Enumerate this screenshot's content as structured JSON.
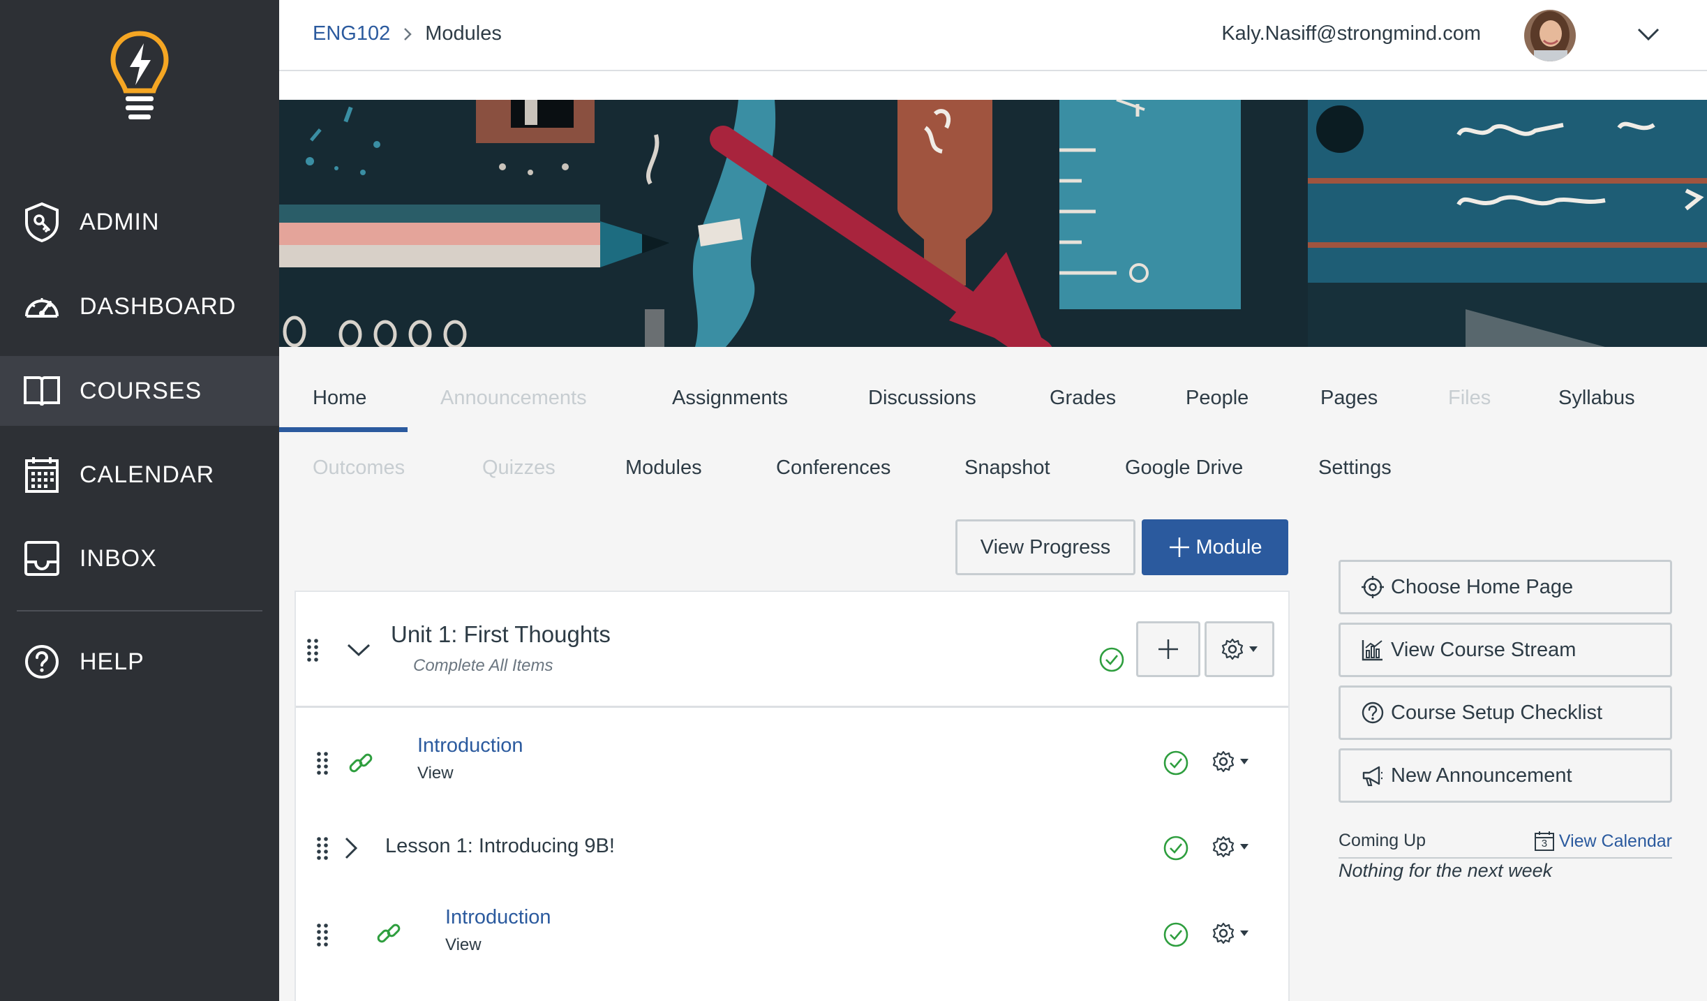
{
  "sidebar": {
    "items": [
      {
        "label": "ADMIN",
        "icon": "shield-icon"
      },
      {
        "label": "DASHBOARD",
        "icon": "speedometer-icon"
      },
      {
        "label": "COURSES",
        "icon": "book-icon"
      },
      {
        "label": "CALENDAR",
        "icon": "calendar-icon"
      },
      {
        "label": "INBOX",
        "icon": "inbox-icon"
      },
      {
        "label": "HELP",
        "icon": "help-circle-icon"
      }
    ],
    "active": "COURSES"
  },
  "header": {
    "breadcrumb_course": "ENG102",
    "breadcrumb_current": "Modules",
    "user_email": "Kaly.Nasiff@strongmind.com"
  },
  "course_nav": {
    "row1": [
      {
        "label": "Home",
        "disabled": false
      },
      {
        "label": "Announcements",
        "disabled": true
      },
      {
        "label": "Assignments",
        "disabled": false
      },
      {
        "label": "Discussions",
        "disabled": false
      },
      {
        "label": "Grades",
        "disabled": false
      },
      {
        "label": "People",
        "disabled": false
      },
      {
        "label": "Pages",
        "disabled": false
      },
      {
        "label": "Files",
        "disabled": true
      },
      {
        "label": "Syllabus",
        "disabled": false
      }
    ],
    "row2": [
      {
        "label": "Outcomes",
        "disabled": true
      },
      {
        "label": "Quizzes",
        "disabled": true
      },
      {
        "label": "Modules",
        "disabled": false
      },
      {
        "label": "Conferences",
        "disabled": false
      },
      {
        "label": "Snapshot",
        "disabled": false
      },
      {
        "label": "Google Drive",
        "disabled": false
      },
      {
        "label": "Settings",
        "disabled": false
      }
    ],
    "active": "Home"
  },
  "toolbar": {
    "view_progress_label": "View Progress",
    "add_module_label": "Module"
  },
  "module": {
    "title": "Unit 1: First Thoughts",
    "requirement": "Complete All Items",
    "items": [
      {
        "type": "link",
        "title": "Introduction",
        "sub": "View"
      },
      {
        "type": "lesson",
        "title": "Lesson 1: Introducing 9B!"
      },
      {
        "type": "link",
        "title": "Introduction",
        "sub": "View"
      }
    ]
  },
  "right_sidebar": {
    "buttons": [
      {
        "label": "Choose Home Page",
        "icon": "target-icon"
      },
      {
        "label": "View Course Stream",
        "icon": "bar-chart-icon"
      },
      {
        "label": "Course Setup Checklist",
        "icon": "question-circle-icon"
      },
      {
        "label": "New Announcement",
        "icon": "megaphone-icon"
      }
    ],
    "coming_up_label": "Coming Up",
    "view_calendar_label": "View Calendar",
    "calendar_day": "3",
    "nothing_label": "Nothing for the next week"
  },
  "colors": {
    "sidebar_bg": "#2d3035",
    "accent_blue": "#2b5a9e",
    "annotation_arrow": "#a8243d",
    "success_green": "#2e9e3e"
  }
}
